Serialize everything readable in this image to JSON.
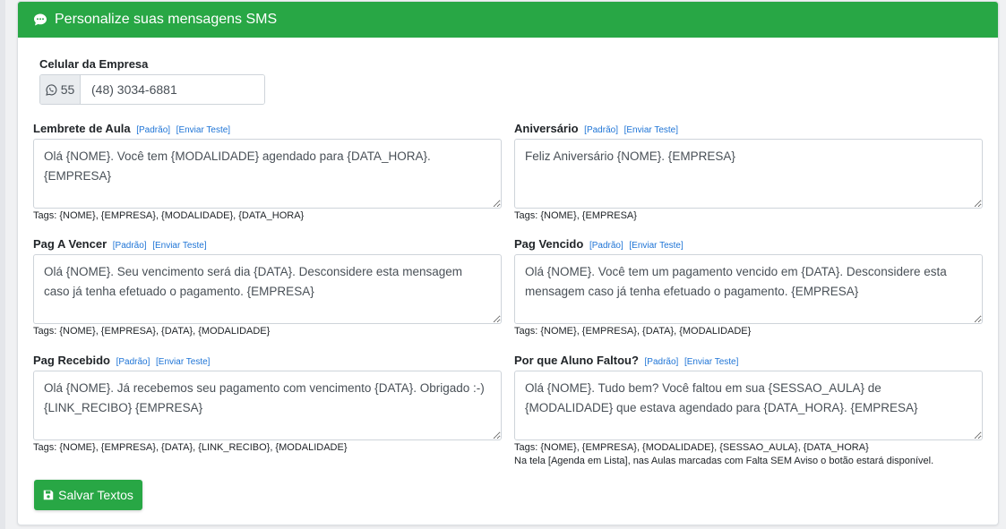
{
  "header": {
    "title": "Personalize suas mensagens SMS",
    "icon": "comment-dots-icon"
  },
  "company": {
    "label": "Celular da Empresa",
    "prefix": "55",
    "prefix_icon": "whatsapp-icon",
    "phone": "(48) 3034-6881"
  },
  "links": {
    "default": "[Padrão]",
    "send_test": "[Enviar Teste]"
  },
  "fields": [
    {
      "label": "Lembrete de Aula",
      "text": "Olá {NOME}. Você tem {MODALIDADE} agendado para {DATA_HORA}. {EMPRESA}",
      "tags": "Tags: {NOME}, {EMPRESA}, {MODALIDADE}, {DATA_HORA}"
    },
    {
      "label": "Aniversário",
      "text": "Feliz Aniversário {NOME}. {EMPRESA}",
      "tags": "Tags: {NOME}, {EMPRESA}"
    },
    {
      "label": "Pag A Vencer",
      "text": "Olá {NOME}. Seu vencimento será dia {DATA}. Desconsidere esta mensagem caso já tenha efetuado o pagamento. {EMPRESA}",
      "tags": "Tags: {NOME}, {EMPRESA}, {DATA}, {MODALIDADE}"
    },
    {
      "label": "Pag Vencido",
      "text": "Olá {NOME}. Você tem um pagamento vencido em {DATA}. Desconsidere esta mensagem caso já tenha efetuado o pagamento. {EMPRESA}",
      "tags": "Tags: {NOME}, {EMPRESA}, {DATA}, {MODALIDADE}"
    },
    {
      "label": "Pag Recebido",
      "text": "Olá {NOME}. Já recebemos seu pagamento com vencimento {DATA}. Obrigado :-) {LINK_RECIBO} {EMPRESA}",
      "tags": "Tags: {NOME}, {EMPRESA}, {DATA}, {LINK_RECIBO}, {MODALIDADE}"
    },
    {
      "label": "Por que Aluno Faltou?",
      "text": "Olá {NOME}. Tudo bem? Você faltou em sua {SESSAO_AULA} de {MODALIDADE} que estava agendado para {DATA_HORA}. {EMPRESA}",
      "tags": "Tags: {NOME}, {EMPRESA}, {MODALIDADE}, {SESSAO_AULA}, {DATA_HORA}",
      "note": "Na tela [Agenda em Lista], nas Aulas marcadas com Falta SEM Aviso o botão estará disponível."
    }
  ],
  "save_button": {
    "label": "Salvar Textos",
    "icon": "floppy-disk-icon"
  }
}
